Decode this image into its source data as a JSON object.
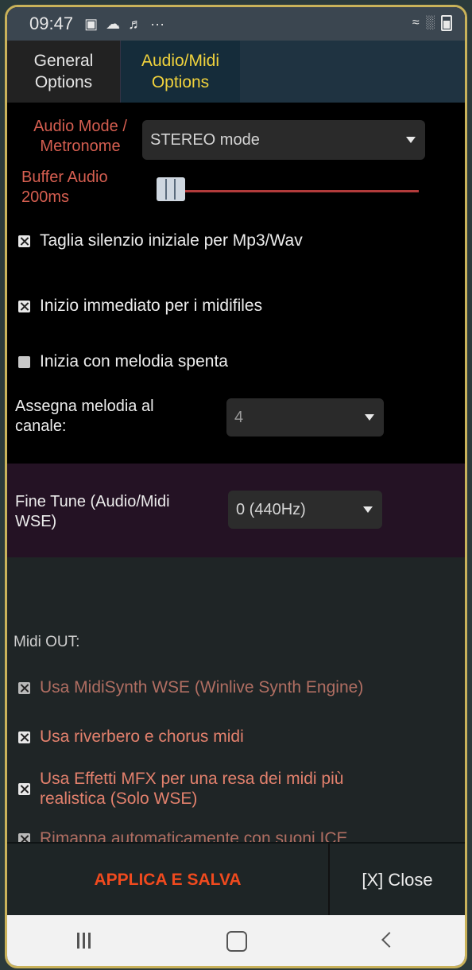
{
  "statusbar": {
    "time": "09:47",
    "icons": [
      "gallery-icon",
      "cloud-icon",
      "app-icon",
      "more-dots-icon"
    ],
    "more": "···"
  },
  "tabs": [
    {
      "label_line1": "General",
      "label_line2": "Options",
      "active": false
    },
    {
      "label_line1": "Audio/Midi",
      "label_line2": "Options",
      "active": true
    }
  ],
  "audio_mode": {
    "label_line1": "Audio Mode /",
    "label_line2": "Metronome",
    "value": "STEREO mode"
  },
  "buffer": {
    "label_line1": "Buffer Audio",
    "label_line2": "200ms",
    "slider_fraction": 0.05
  },
  "options": {
    "trim_silence": {
      "label": "Taglia silenzio iniziale per Mp3/Wav",
      "checked": true
    },
    "immediate_start": {
      "label": "Inizio immediato per i midifiles",
      "checked": true
    },
    "melody_off": {
      "label": "Inizia con melodia spenta",
      "checked": false
    }
  },
  "melody_channel": {
    "label_line1": "Assegna melodia al",
    "label_line2": "canale:",
    "value": "4"
  },
  "fine_tune": {
    "label_line1": "Fine Tune (Audio/Midi",
    "label_line2": "WSE)",
    "value": "0 (440Hz)"
  },
  "midi_out": {
    "heading": "Midi OUT:",
    "items": [
      {
        "label": "Usa MidiSynth WSE (Winlive Synth Engine)",
        "checked": true
      },
      {
        "label": "Usa riverbero e chorus midi",
        "checked": true
      },
      {
        "label_line1": "Usa Effetti MFX per una resa dei midi più",
        "label_line2": "realistica (Solo WSE)",
        "checked": true
      },
      {
        "label": "Rimappa automaticamente con suoni ICE",
        "checked": true
      }
    ]
  },
  "actions": {
    "apply": "APPLICA E SALVA",
    "close": "[X] Close"
  },
  "colors": {
    "accent_tab": "#f0d23c",
    "label_red": "#d55e50",
    "apply": "#f04a1e",
    "frame": "#c9b25a"
  }
}
